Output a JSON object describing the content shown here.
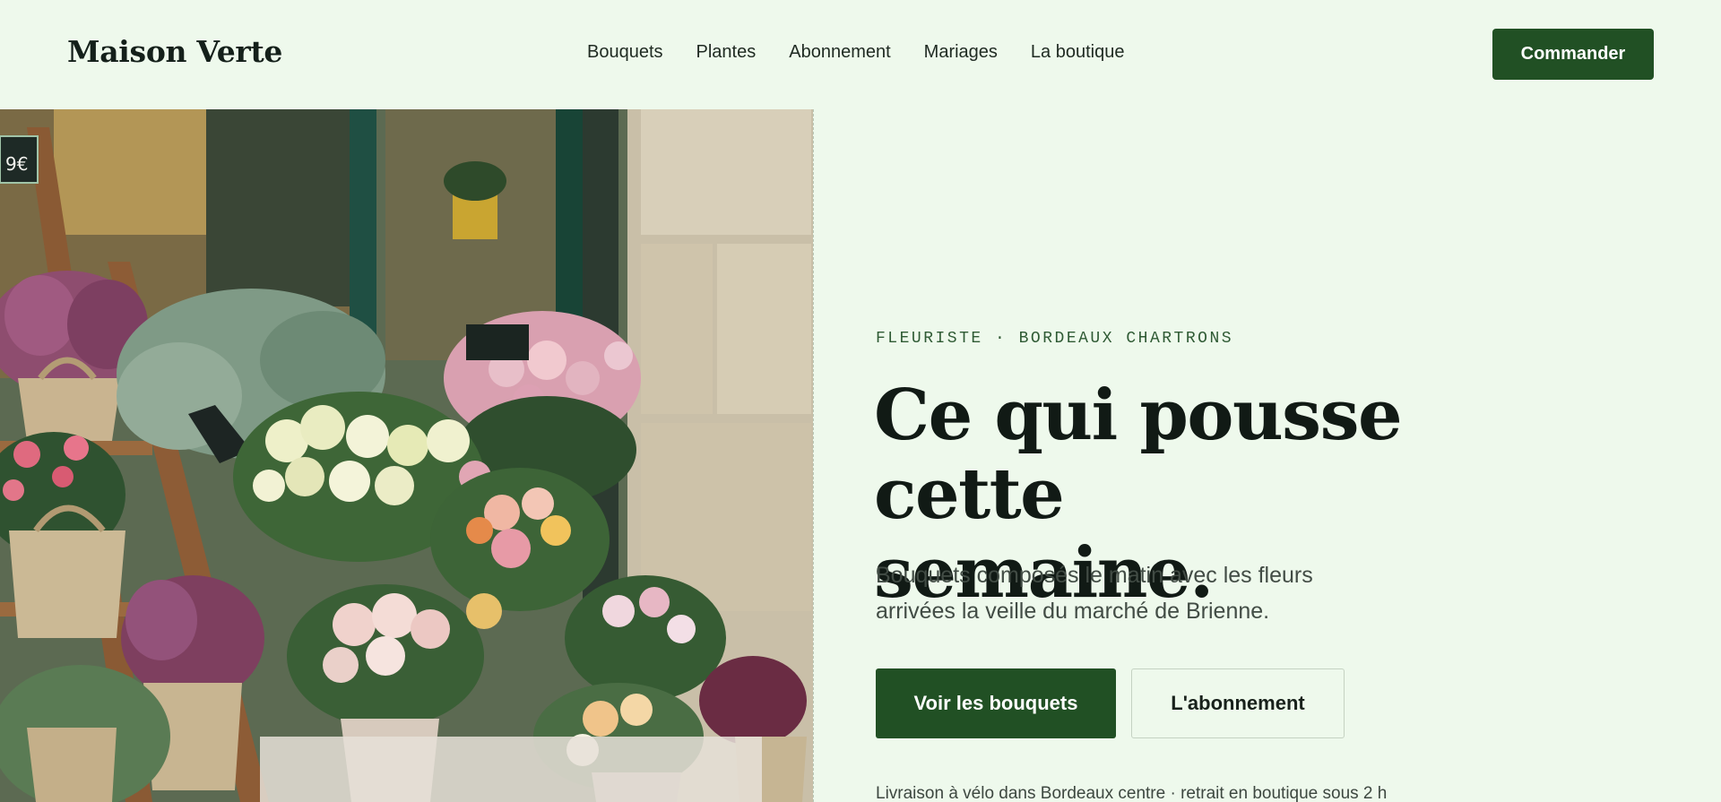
{
  "header": {
    "logo": "Maison Verte",
    "nav": [
      "Bouquets",
      "Plantes",
      "Abonnement",
      "Mariages",
      "La boutique"
    ],
    "cta": "Commander"
  },
  "hero": {
    "eyebrow": "FLEURISTE · BORDEAUX CHARTRONS",
    "headline_line1": "Ce qui pousse cette",
    "headline_line2": "semaine.",
    "lede_line1": "Bouquets composés le matin avec les fleurs",
    "lede_line2": "arrivées la veille du marché de Brienne.",
    "primary_cta": "Voir les bouquets",
    "secondary_cta": "L'abonnement",
    "delivery_note": "Livraison à vélo dans Bordeaux centre · retrait en boutique sous 2 h",
    "price_tag": "9€"
  },
  "colors": {
    "background": "#eef9ec",
    "accent": "#215024",
    "text": "#111a15"
  }
}
